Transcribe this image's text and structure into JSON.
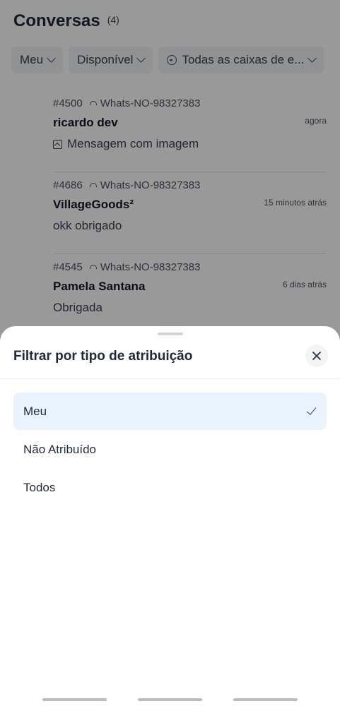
{
  "header": {
    "title": "Conversas",
    "count": "(4)"
  },
  "filters": [
    {
      "label": "Meu"
    },
    {
      "label": "Disponível"
    },
    {
      "label": "Todas as caixas de e..."
    }
  ],
  "conversations": [
    {
      "id": "#4500",
      "inbox": "Whats-NO-98327383",
      "name": "ricardo dev",
      "time": "agora",
      "message": "Mensagem com imagem",
      "has_image": true
    },
    {
      "id": "#4686",
      "inbox": "Whats-NO-98327383",
      "name": "VillageGoods²",
      "time": "15 minutos atrás",
      "message": "okk obrigado",
      "has_image": false
    },
    {
      "id": "#4545",
      "inbox": "Whats-NO-98327383",
      "name": "Pamela Santana",
      "time": "6 dias atrás",
      "message": "Obrigada",
      "has_image": false
    }
  ],
  "sheet": {
    "title": "Filtrar por tipo de atribuição",
    "options": [
      {
        "label": "Meu",
        "selected": true
      },
      {
        "label": "Não Atribuído",
        "selected": false
      },
      {
        "label": "Todos",
        "selected": false
      }
    ]
  },
  "colors": {
    "selected_bg": "#eaf3fd",
    "overlay": "rgba(0,0,0,0.40)"
  }
}
